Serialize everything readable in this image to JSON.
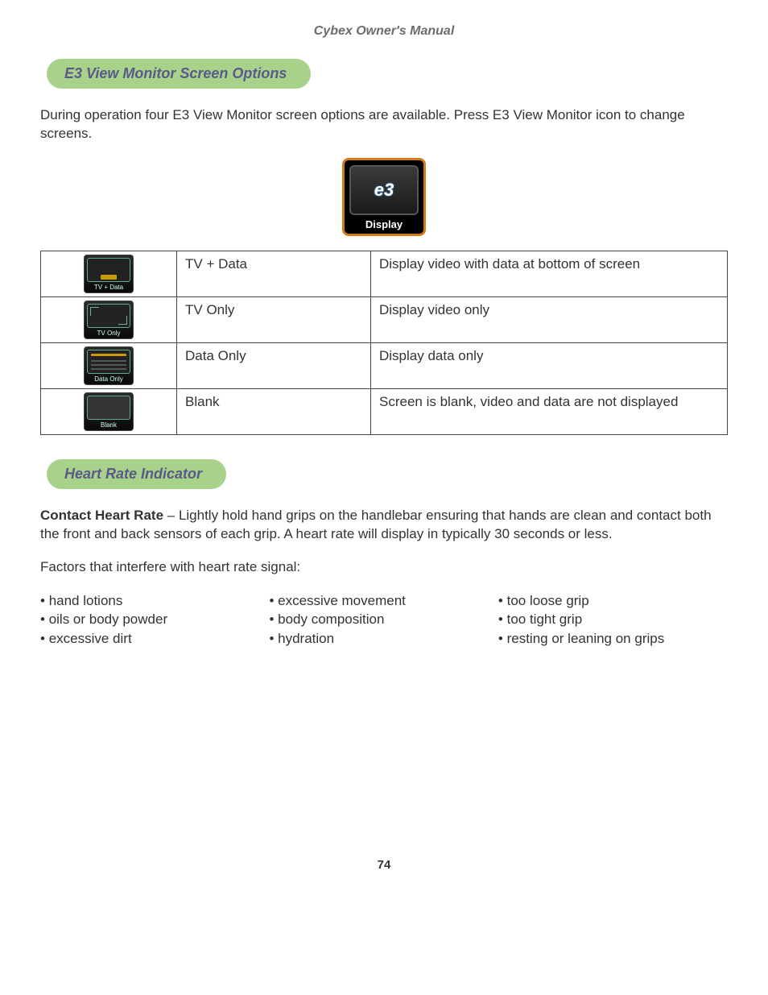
{
  "header": "Cybex Owner's Manual",
  "section1_title": "E3 View Monitor Screen Options",
  "intro": "During operation four E3 View Monitor screen options are available. Press E3 View Monitor icon to change screens.",
  "display_icon_label": "Display",
  "options": [
    {
      "icon_label": "TV + Data",
      "name": "TV + Data",
      "desc": "Display video with data at bottom of screen"
    },
    {
      "icon_label": "TV Only",
      "name": "TV Only",
      "desc": "Display video only"
    },
    {
      "icon_label": "Data Only",
      "name": "Data Only",
      "desc": "Display data only"
    },
    {
      "icon_label": "Blank",
      "name": "Blank",
      "desc": "Screen is blank, video and data are not displayed"
    }
  ],
  "section2_title": "Heart Rate Indicator",
  "contact_label": "Contact Heart Rate",
  "contact_text": " –  Lightly hold hand grips on the handlebar ensuring that hands are clean and contact both the front and back sensors of each grip. A heart rate will display in typically 30 seconds or less.",
  "factors_intro": "Factors that interfere with heart rate signal:",
  "factors_col1": [
    "hand lotions",
    "oils or body powder",
    "excessive dirt"
  ],
  "factors_col2": [
    "excessive movement",
    "body composition",
    "hydration"
  ],
  "factors_col3": [
    "too loose grip",
    "too tight grip",
    "resting or leaning on grips"
  ],
  "page_number": "74"
}
